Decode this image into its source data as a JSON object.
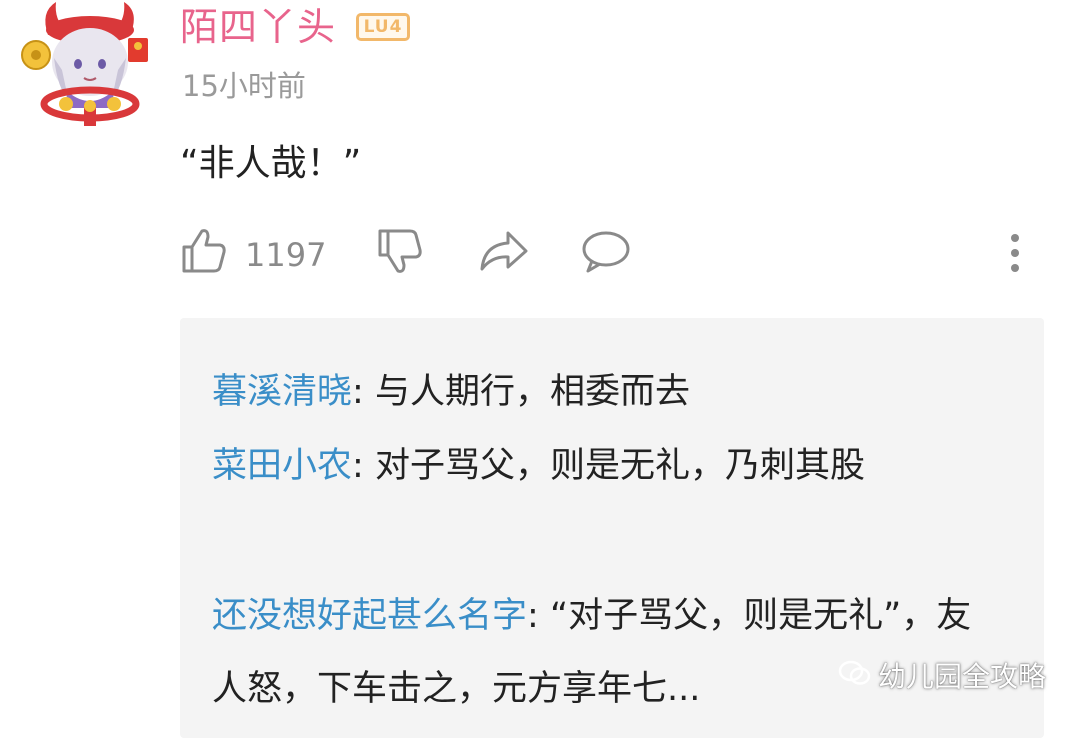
{
  "comment": {
    "username": "陌四丫头",
    "level_badge": "LU4",
    "timestamp": "15小时前",
    "text": "“非人哉！”",
    "likes": "1197"
  },
  "actions": {
    "like_icon": "thumbs-up-icon",
    "dislike_icon": "thumbs-down-icon",
    "share_icon": "share-icon",
    "reply_icon": "comment-bubble-icon",
    "more_icon": "more-vertical-icon"
  },
  "replies": [
    {
      "author": "暮溪清晓",
      "separator": ": ",
      "text": "与人期行，相委而去"
    },
    {
      "author": "菜田小农",
      "separator": ": ",
      "text": "对子骂父，则是无礼，乃刺其股"
    },
    {
      "author": "还没想好起甚么名字",
      "separator": ": ",
      "text": "“对子骂父，则是无礼”，友人怒，下车击之，元方享年七..."
    }
  ],
  "watermark": {
    "text": "幼儿园全攻略",
    "icon": "wechat-icon"
  },
  "colors": {
    "username": "#e8648c",
    "badge": "#f2b86a",
    "reply_author": "#3a8ec8",
    "reply_bg": "#f4f4f4",
    "muted": "#9a9a9a"
  }
}
